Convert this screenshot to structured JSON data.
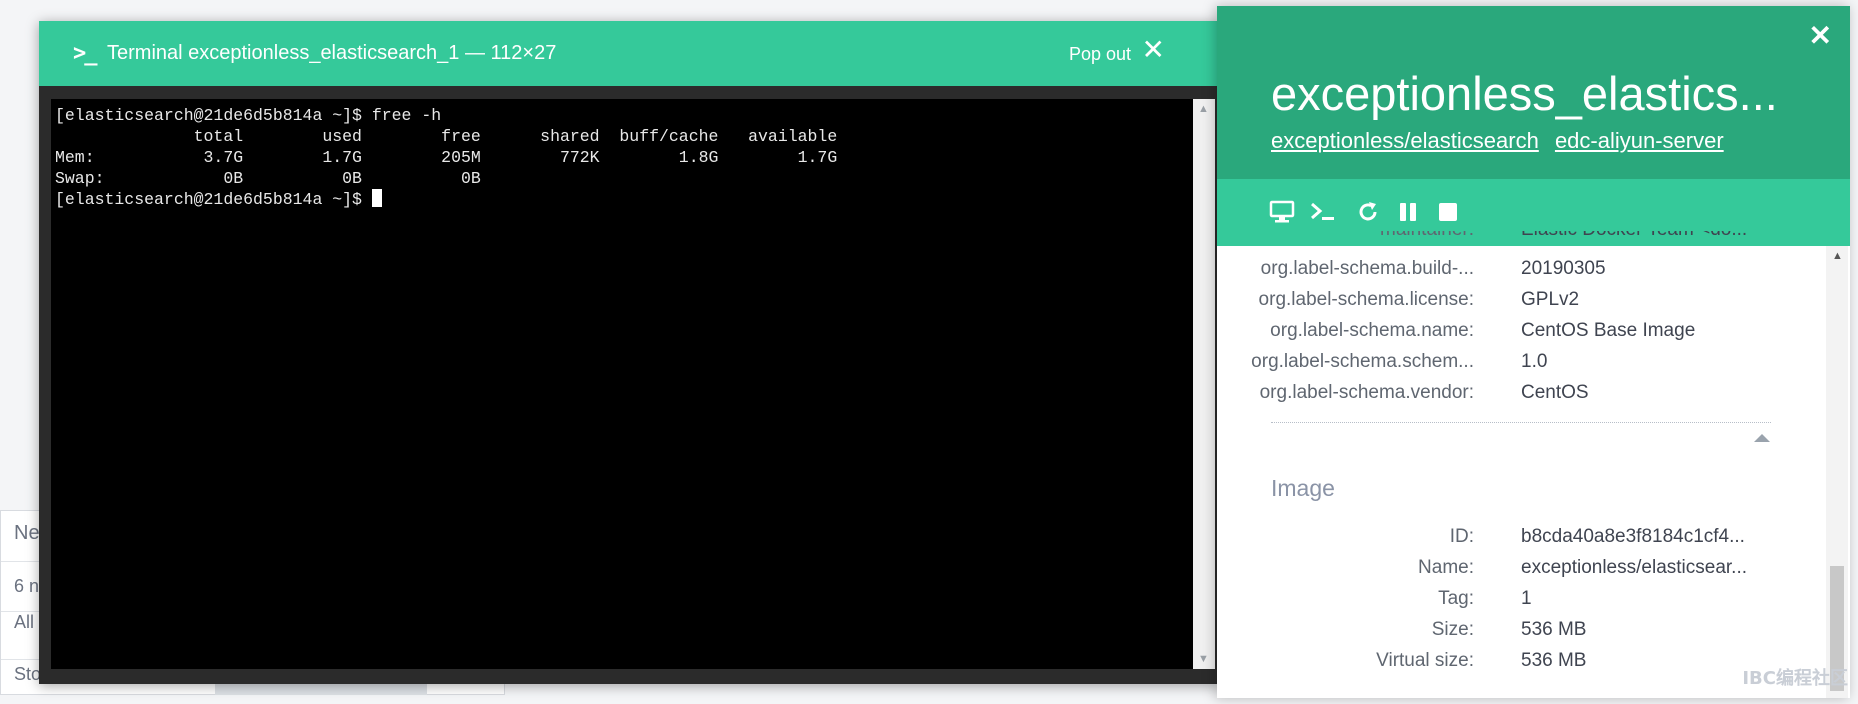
{
  "background": {
    "fragments": [
      "Ne",
      "6 n",
      "All",
      "Stop"
    ]
  },
  "terminal": {
    "title": "Terminal exceptionless_elasticsearch_1 — 112×27",
    "popout_label": "Pop out",
    "close_glyph": "✕",
    "output": "[elasticsearch@21de6d5b814a ~]$ free -h\n              total        used        free      shared  buff/cache   available\nMem:           3.7G        1.7G        205M        772K        1.8G        1.7G\nSwap:            0B          0B          0B\n[elasticsearch@21de6d5b814a ~]$ "
  },
  "panel": {
    "title": "exceptionless_elastics...",
    "links": [
      "exceptionless/elasticsearch",
      "edc-aliyun-server"
    ],
    "close_glyph": "✕",
    "toolbar": [
      "monitor-icon",
      "terminal-icon",
      "restart-icon",
      "pause-icon",
      "stop-icon"
    ],
    "labels": [
      {
        "key": "maintainer:",
        "value": "Elastic Docker Team <do..."
      },
      {
        "key": "org.label-schema.build-...",
        "value": "20190305"
      },
      {
        "key": "org.label-schema.license:",
        "value": "GPLv2"
      },
      {
        "key": "org.label-schema.name:",
        "value": "CentOS Base Image"
      },
      {
        "key": "org.label-schema.schem...",
        "value": "1.0"
      },
      {
        "key": "org.label-schema.vendor:",
        "value": "CentOS"
      }
    ],
    "image_section": {
      "title": "Image",
      "rows": [
        {
          "key": "ID:",
          "value": "b8cda40a8e3f8184c1cf4..."
        },
        {
          "key": "Name:",
          "value": "exceptionless/elasticsear..."
        },
        {
          "key": "Tag:",
          "value": "1"
        },
        {
          "key": "Size:",
          "value": "536 MB"
        },
        {
          "key": "Virtual size:",
          "value": "536 MB"
        }
      ]
    }
  },
  "watermark": "IBC编程社区",
  "colors": {
    "header_dark": "#2aa87c",
    "header_light": "#35c99a",
    "terminal_bg": "#000000"
  }
}
